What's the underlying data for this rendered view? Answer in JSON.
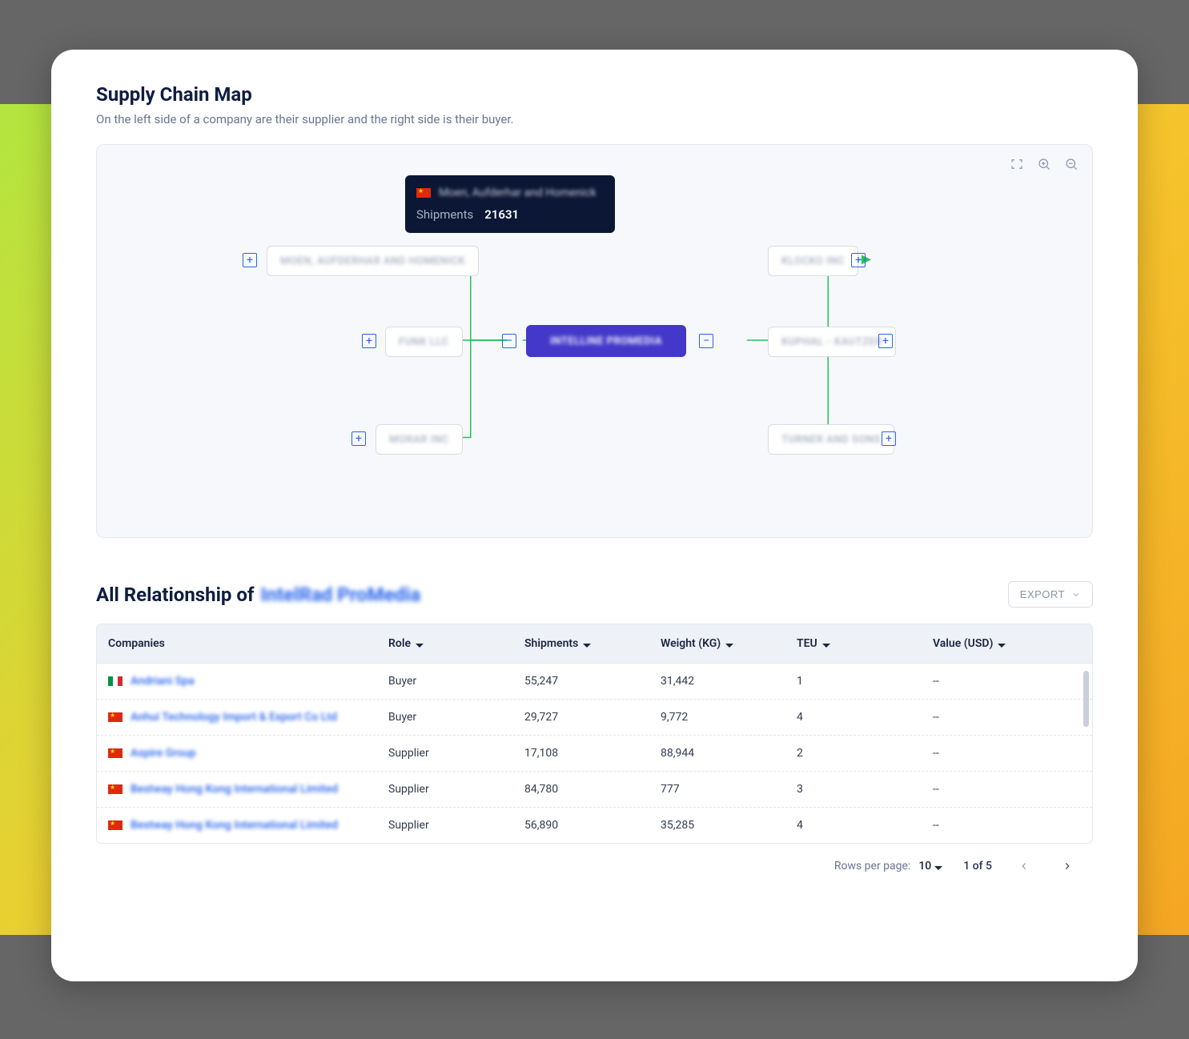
{
  "header": {
    "title": "Supply Chain Map",
    "subtitle": "On the left side of a company are their supplier and the right side is their buyer."
  },
  "tooltip": {
    "name": "Moen, Aufderhar and Homenick",
    "stat_label": "Shipments",
    "stat_value": "21631"
  },
  "nodes": {
    "s1": "MOEN, AUFDERHAR AND HOMENICK",
    "s2": "FUNK LLC",
    "s3": "MORAR INC",
    "center": "INTELLINE PROMEDIA",
    "b1": "KLOCKO INC",
    "b2": "KUPHAL - KAUTZER",
    "b3": "TURNER AND SONS"
  },
  "relationship": {
    "title_prefix": "All Relationship of",
    "company_name": "IntelRad ProMedia",
    "export_label": "EXPORT",
    "columns": {
      "company": "Companies",
      "role": "Role",
      "shipments": "Shipments",
      "weight": "Weight (KG)",
      "teu": "TEU",
      "value": "Value (USD)"
    },
    "rows": [
      {
        "flag": "it",
        "company": "Andriani Spa",
        "role": "Buyer",
        "shipments": "55,247",
        "weight": "31,442",
        "teu": "1",
        "value": "--"
      },
      {
        "flag": "cn",
        "company": "Anhui Technology Import & Export Co Ltd",
        "role": "Buyer",
        "shipments": "29,727",
        "weight": "9,772",
        "teu": "4",
        "value": "--"
      },
      {
        "flag": "cn",
        "company": "Aspire Group",
        "role": "Supplier",
        "shipments": "17,108",
        "weight": "88,944",
        "teu": "2",
        "value": "--"
      },
      {
        "flag": "cn",
        "company": "Bestway Hong Kong International Limited",
        "role": "Supplier",
        "shipments": "84,780",
        "weight": "777",
        "teu": "3",
        "value": "--"
      },
      {
        "flag": "cn",
        "company": "Bestway Hong Kong International Limited",
        "role": "Supplier",
        "shipments": "56,890",
        "weight": "35,285",
        "teu": "4",
        "value": "--"
      }
    ]
  },
  "pagination": {
    "rows_label": "Rows per page:",
    "rows_value": "10",
    "position": "1 of 5"
  }
}
